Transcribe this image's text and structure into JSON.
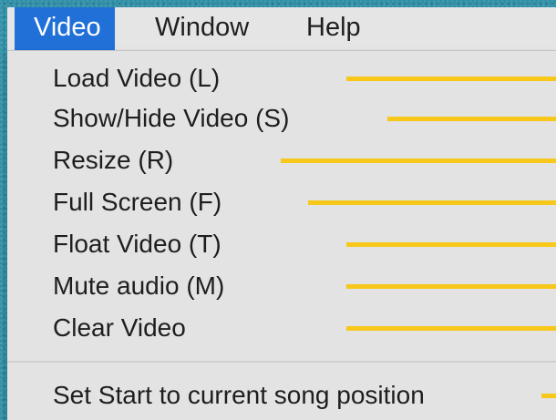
{
  "menubar": {
    "items": [
      {
        "label": "Video",
        "active": true
      },
      {
        "label": "Window",
        "active": false
      },
      {
        "label": "Help",
        "active": false
      }
    ]
  },
  "video_menu": {
    "items": [
      {
        "label": "Load Video (L)"
      },
      {
        "label": "Show/Hide Video (S)"
      },
      {
        "label": "Resize (R)"
      },
      {
        "label": "Full Screen (F)"
      },
      {
        "label": "Float Video (T)"
      },
      {
        "label": "Mute audio (M)"
      },
      {
        "label": "Clear Video"
      },
      {
        "label": "Set Start to current song position"
      }
    ]
  },
  "colors": {
    "menubar_active_bg": "#2070d8",
    "menu_bg": "#e3e3e3",
    "pointer_line": "#f7c81a",
    "background": "#2e8fa6"
  }
}
